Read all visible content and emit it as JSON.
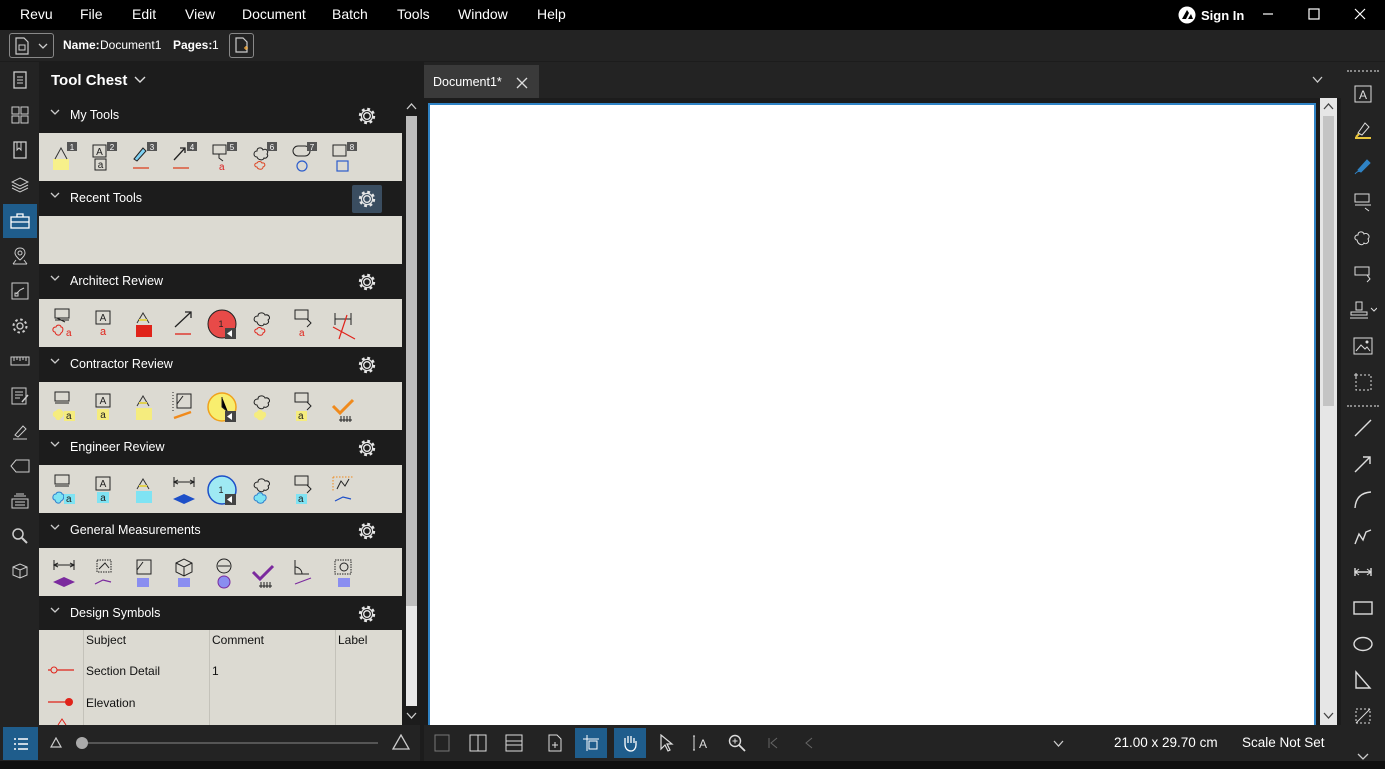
{
  "menu": [
    "Revu",
    "File",
    "Edit",
    "View",
    "Document",
    "Batch",
    "Tools",
    "Window",
    "Help"
  ],
  "sign_in": "Sign In",
  "document": {
    "name_label": "Name:",
    "name": "Document1",
    "pages_label": "Pages:",
    "pages": "1"
  },
  "panel": {
    "title": "Tool Chest",
    "sections": [
      {
        "title": "My Tools"
      },
      {
        "title": "Recent Tools"
      },
      {
        "title": "Architect Review"
      },
      {
        "title": "Contractor Review"
      },
      {
        "title": "Engineer Review"
      },
      {
        "title": "General Measurements"
      },
      {
        "title": "Design Symbols"
      }
    ],
    "my_tools_numbers": [
      "1",
      "2",
      "3",
      "4",
      "5",
      "6",
      "7",
      "8"
    ],
    "table": {
      "columns": [
        "Subject",
        "Comment",
        "Label"
      ],
      "rows": [
        {
          "subject": "Section Detail",
          "comment": "1",
          "label": ""
        },
        {
          "subject": "Elevation",
          "comment": "",
          "label": ""
        }
      ]
    }
  },
  "tab": {
    "label": "Document1*"
  },
  "status": {
    "size": "21.00 x 29.70 cm",
    "scale": "Scale Not Set"
  },
  "colors": {
    "accent": "#1f5d8c",
    "page_border": "#2f83c5",
    "panel_bg": "#dcdad2",
    "architect": "#e0231a",
    "contractor": "#f5ec7e",
    "engineer": "#7fe3f3",
    "measure": "#7b2a9e"
  }
}
